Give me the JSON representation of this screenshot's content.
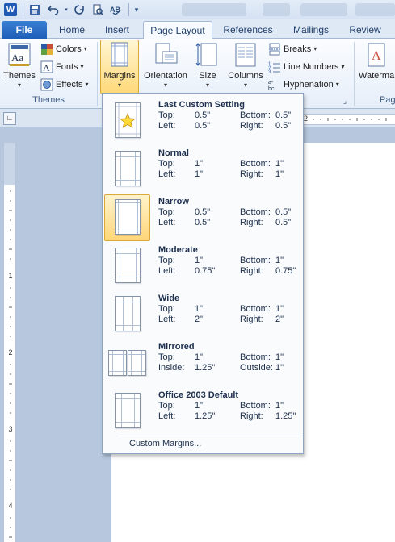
{
  "qat": {
    "word_logo": "W"
  },
  "tabs": [
    "File",
    "Home",
    "Insert",
    "Page Layout",
    "References",
    "Mailings",
    "Review"
  ],
  "ribbon": {
    "themes_label": "Themes",
    "colors_label": "Colors",
    "fonts_label": "Fonts",
    "effects_label": "Effects",
    "themes_group_label": "Themes",
    "margins_label": "Margins",
    "orientation_label": "Orientation",
    "size_label": "Size",
    "columns_label": "Columns",
    "breaks_label": "Breaks",
    "line_numbers_label": "Line Numbers",
    "hyphenation_label": "Hyphenation",
    "watermark_label": "Waterma",
    "page_group_label": "Pag"
  },
  "ruler": {
    "h_mark": "2",
    "v_numbers": [
      "1",
      "2",
      "3",
      "4"
    ]
  },
  "margins_menu": {
    "items": [
      {
        "title": "Last Custom Setting",
        "k1": "Top:",
        "v1": "0.5\"",
        "k2": "Bottom:",
        "v2": "0.5\"",
        "k3": "Left:",
        "v3": "0.5\"",
        "k4": "Right:",
        "v4": "0.5\""
      },
      {
        "title": "Normal",
        "k1": "Top:",
        "v1": "1\"",
        "k2": "Bottom:",
        "v2": "1\"",
        "k3": "Left:",
        "v3": "1\"",
        "k4": "Right:",
        "v4": "1\""
      },
      {
        "title": "Narrow",
        "k1": "Top:",
        "v1": "0.5\"",
        "k2": "Bottom:",
        "v2": "0.5\"",
        "k3": "Left:",
        "v3": "0.5\"",
        "k4": "Right:",
        "v4": "0.5\""
      },
      {
        "title": "Moderate",
        "k1": "Top:",
        "v1": "1\"",
        "k2": "Bottom:",
        "v2": "1\"",
        "k3": "Left:",
        "v3": "0.75\"",
        "k4": "Right:",
        "v4": "0.75\""
      },
      {
        "title": "Wide",
        "k1": "Top:",
        "v1": "1\"",
        "k2": "Bottom:",
        "v2": "1\"",
        "k3": "Left:",
        "v3": "2\"",
        "k4": "Right:",
        "v4": "2\""
      },
      {
        "title": "Mirrored",
        "k1": "Top:",
        "v1": "1\"",
        "k2": "Bottom:",
        "v2": "1\"",
        "k3": "Inside:",
        "v3": "1.25\"",
        "k4": "Outside:",
        "v4": "1\""
      },
      {
        "title": "Office 2003 Default",
        "k1": "Top:",
        "v1": "1\"",
        "k2": "Bottom:",
        "v2": "1\"",
        "k3": "Left:",
        "v3": "1.25\"",
        "k4": "Right:",
        "v4": "1.25\""
      }
    ],
    "selected": "Narrow",
    "custom_label": "Custom Margins..."
  },
  "colors": {
    "file_tab": "#1e5eb8",
    "highlight": "#ffd97a"
  }
}
